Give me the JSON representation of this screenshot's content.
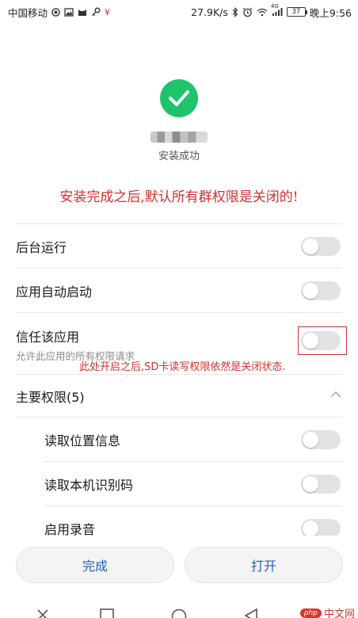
{
  "status_bar": {
    "carrier": "中国移动",
    "net_speed": "27.9K/s",
    "battery": "37",
    "time": "晚上9:56",
    "signal_label": "4G",
    "currency_mark": "¥"
  },
  "install": {
    "status_text": "安装成功"
  },
  "annotations": {
    "top_note": "安装完成之后,默认所有群权限是关闭的!",
    "toggle_note": "此处开启之后,SD卡读写权限依然是关闭状态."
  },
  "settings": {
    "background_run": "后台运行",
    "auto_start": "应用自动启动",
    "trust_app": "信任该应用",
    "trust_app_sub": "允许此应用的所有权限请求",
    "main_permissions": "主要权限(5)"
  },
  "permissions": [
    {
      "label": "读取位置信息"
    },
    {
      "label": "读取本机识别码"
    },
    {
      "label": "启用录音"
    }
  ],
  "buttons": {
    "done": "完成",
    "open": "打开"
  },
  "watermark": {
    "badge": "php",
    "text": "中文网"
  },
  "colors": {
    "success_green": "#1fc46a",
    "annotation_red": "#d0312d",
    "button_text_blue": "#1f5fc7"
  }
}
